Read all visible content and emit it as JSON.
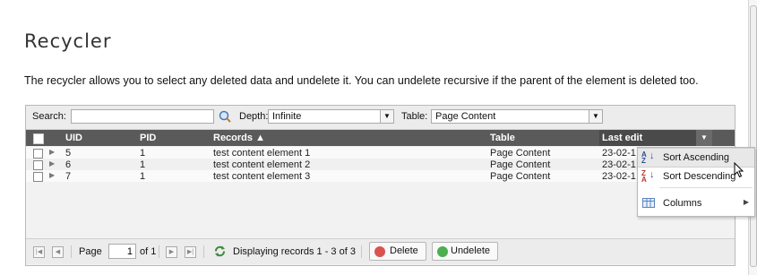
{
  "page": {
    "title": "Recycler",
    "description": "The recycler allows you to select any deleted data and undelete it. You can undelete recursive if the parent of the element is deleted too."
  },
  "toolbar": {
    "search_label": "Search:",
    "search_value": "",
    "depth_label": "Depth:",
    "depth_value": "Infinite",
    "table_label": "Table:",
    "table_value": "Page Content"
  },
  "grid": {
    "columns": {
      "uid": "UID",
      "pid": "PID",
      "records": "Records ▲",
      "table": "Table",
      "last_edit": "Last edit"
    },
    "rows": [
      {
        "uid": "5",
        "pid": "1",
        "record": "test content element 1",
        "table": "Page Content",
        "last_edit": "23-02-1"
      },
      {
        "uid": "6",
        "pid": "1",
        "record": "test content element 2",
        "table": "Page Content",
        "last_edit": "23-02-1"
      },
      {
        "uid": "7",
        "pid": "1",
        "record": "test content element 3",
        "table": "Page Content",
        "last_edit": "23-02-1"
      }
    ]
  },
  "pager": {
    "page_label": "Page",
    "page_value": "1",
    "of_label": "of 1",
    "display_text": "Displaying records 1 - 3 of 3",
    "delete_label": "Delete",
    "undelete_label": "Undelete"
  },
  "column_menu": {
    "sort_asc": "Sort Ascending",
    "sort_desc": "Sort Descending",
    "columns": "Columns"
  },
  "colors": {
    "header_bg": "#5a5a5a",
    "delete_icon": "#d9534f",
    "undelete_icon": "#4caf50",
    "sort_icon": "#2b4f8f"
  },
  "icons": [
    "search-icon",
    "chevron-down-icon",
    "first-page-icon",
    "prev-page-icon",
    "next-page-icon",
    "last-page-icon",
    "refresh-icon",
    "delete-icon",
    "undelete-icon",
    "sort-ascending-icon",
    "sort-descending-icon",
    "columns-icon",
    "cursor-icon"
  ]
}
